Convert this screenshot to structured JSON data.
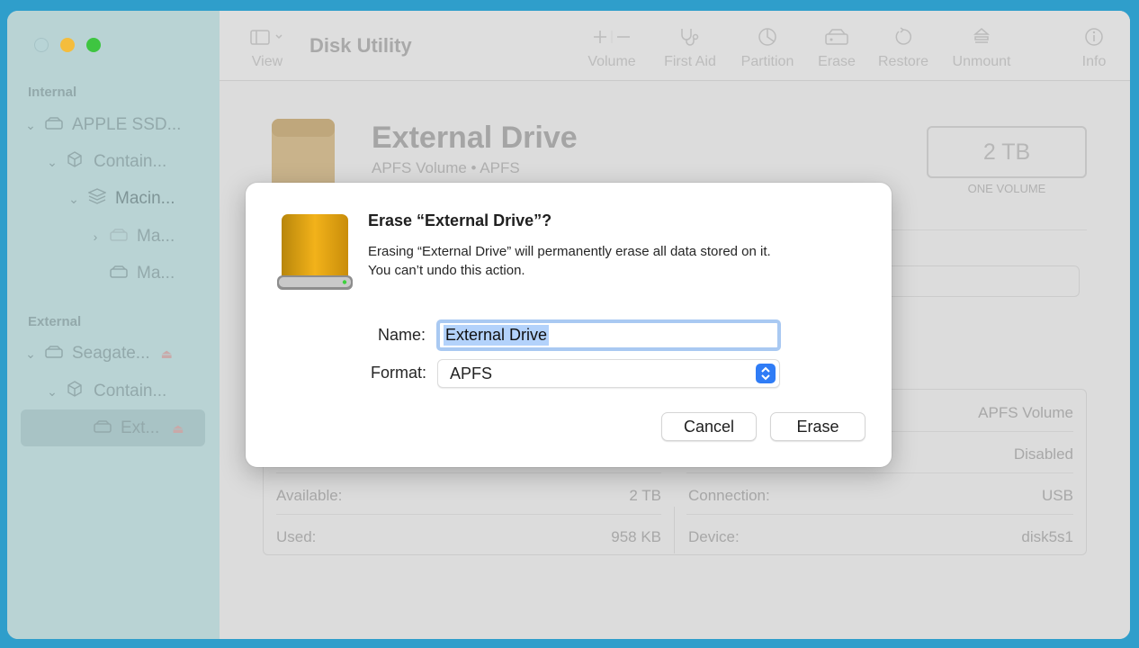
{
  "window": {
    "title": "Disk Utility"
  },
  "toolbar": {
    "view_label": "View",
    "volume_label": "Volume",
    "first_aid_label": "First Aid",
    "partition_label": "Partition",
    "erase_label": "Erase",
    "restore_label": "Restore",
    "unmount_label": "Unmount",
    "info_label": "Info"
  },
  "sidebar": {
    "internal_header": "Internal",
    "external_header": "External",
    "internal_items": [
      {
        "label": "APPLE SSD...",
        "icon": "disk-icon"
      },
      {
        "label": "Contain...",
        "icon": "container-icon"
      },
      {
        "label": "Macin...",
        "icon": "volume-group-icon"
      },
      {
        "label": "Ma...",
        "icon": "disk-icon"
      },
      {
        "label": "Ma...",
        "icon": "disk-icon"
      }
    ],
    "external_items": [
      {
        "label": "Seagate...",
        "icon": "disk-icon"
      },
      {
        "label": "Contain...",
        "icon": "container-icon"
      },
      {
        "label": "Ext...",
        "icon": "disk-icon"
      }
    ]
  },
  "volume": {
    "name": "External Drive",
    "subtitle": "APFS Volume • APFS",
    "capacity": "2 TB",
    "capacity_label": "ONE VOLUME"
  },
  "info": {
    "type_value": "APFS Volume",
    "owners_value": "Disabled",
    "available_label": "Available:",
    "available_value": "2 TB",
    "used_label": "Used:",
    "used_value": "958 KB",
    "connection_label": "Connection:",
    "connection_value": "USB",
    "device_label": "Device:",
    "device_value": "disk5s1"
  },
  "dialog": {
    "title": "Erase “External Drive”?",
    "message_line1": "Erasing “External Drive” will permanently erase all data stored on it.",
    "message_line2": "You can’t undo this action.",
    "name_label": "Name:",
    "name_value": "External Drive",
    "format_label": "Format:",
    "format_value": "APFS",
    "cancel_label": "Cancel",
    "erase_label": "Erase",
    "accent_color": "#2f7cf6"
  }
}
